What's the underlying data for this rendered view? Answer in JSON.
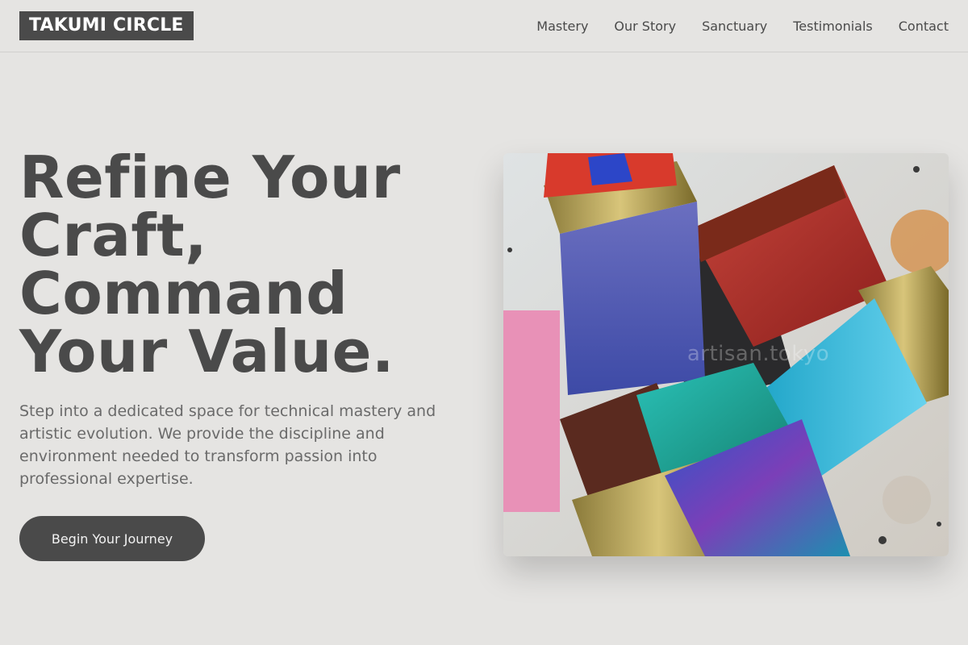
{
  "header": {
    "logo": "TAKUMI CIRCLE",
    "nav": [
      "Mastery",
      "Our Story",
      "Sanctuary",
      "Testimonials",
      "Contact"
    ]
  },
  "hero": {
    "headline": [
      "Refine Your",
      "Craft,",
      "Command",
      "Your Value."
    ],
    "subtitle": "Step into a dedicated space for technical mastery and artistic evolution. We provide the discipline and environment needed to transform passion into professional expertise.",
    "cta": "Begin Your Journey",
    "image": {
      "description_icon": "paint-brushes-image",
      "watermark": "artisan.tokyo"
    }
  },
  "colors": {
    "background": "#e5e4e2",
    "primary": "#4a4a4a",
    "text_muted": "#6a6a6a",
    "button_text": "#f2f2f2"
  }
}
